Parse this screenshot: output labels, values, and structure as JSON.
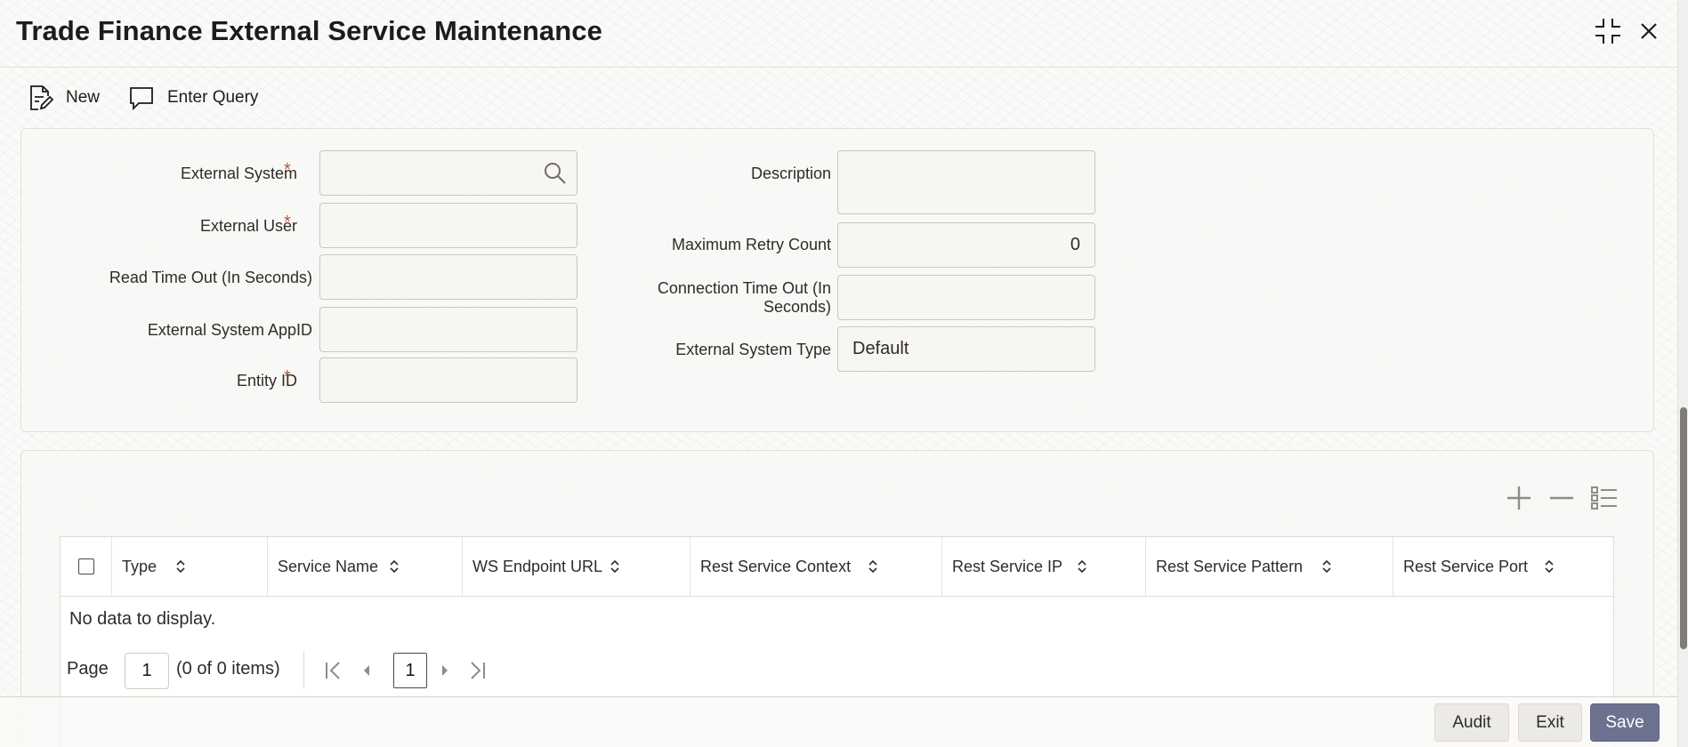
{
  "window": {
    "title": "Trade Finance External Service Maintenance"
  },
  "toolbar": {
    "new_label": "New",
    "enter_query_label": "Enter Query"
  },
  "form": {
    "external_system": {
      "label": "External System",
      "value": ""
    },
    "external_user": {
      "label": "External User",
      "value": ""
    },
    "read_time_out": {
      "label": "Read Time Out (In Seconds)",
      "value": ""
    },
    "external_system_appid": {
      "label": "External System AppID",
      "value": ""
    },
    "entity_id": {
      "label": "Entity ID",
      "value": ""
    },
    "description": {
      "label": "Description",
      "value": ""
    },
    "max_retry_count": {
      "label": "Maximum Retry Count",
      "value": "0"
    },
    "connection_time_out": {
      "label_line1": "Connection Time Out (In",
      "label_line2": "Seconds)",
      "value": ""
    },
    "external_system_type": {
      "label": "External System Type",
      "value": "Default"
    },
    "required_marker": "*"
  },
  "grid": {
    "columns": [
      "Type",
      "Service Name",
      "WS Endpoint URL",
      "Rest Service Context",
      "Rest Service IP",
      "Rest Service Pattern",
      "Rest Service Port"
    ],
    "empty_message": "No data to display.",
    "pager": {
      "page_label": "Page",
      "page_input": "1",
      "items_summary": "(0 of 0 items)",
      "current_page": "1"
    }
  },
  "footer": {
    "audit_label": "Audit",
    "exit_label": "Exit",
    "save_label": "Save"
  },
  "icons": [
    "document-edit-icon",
    "comment-icon",
    "search-icon",
    "collapse-icon",
    "close-icon",
    "add-icon",
    "remove-icon",
    "list-icon",
    "sort-icon",
    "first-page-icon",
    "prev-page-icon",
    "next-page-icon",
    "last-page-icon"
  ],
  "colors": {
    "primary_button": "#6c7290",
    "required": "#b35c3a"
  }
}
